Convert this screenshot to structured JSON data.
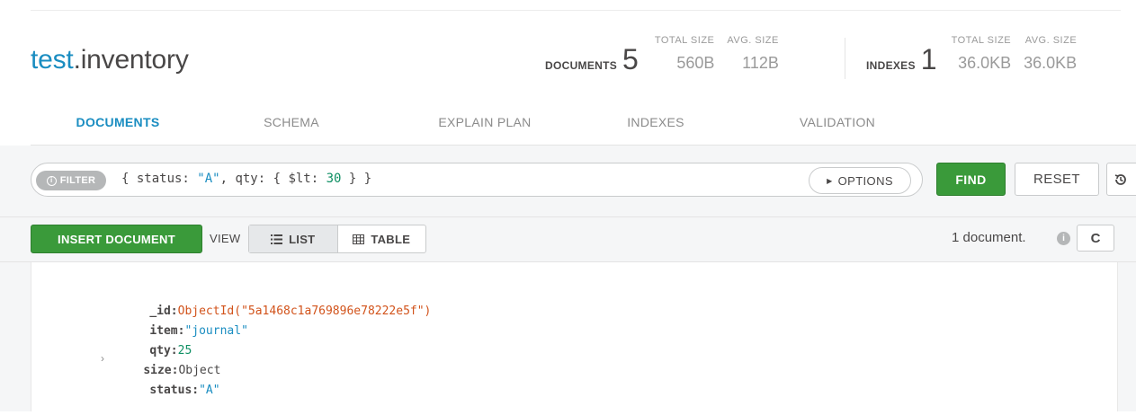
{
  "header": {
    "db": "test",
    "collection": ".inventory",
    "documents": {
      "label": "DOCUMENTS",
      "count": "5",
      "total_size_label": "TOTAL SIZE",
      "total_size": "560B",
      "avg_size_label": "AVG. SIZE",
      "avg_size": "112B"
    },
    "indexes": {
      "label": "INDEXES",
      "count": "1",
      "total_size_label": "TOTAL SIZE",
      "total_size": "36.0KB",
      "avg_size_label": "AVG. SIZE",
      "avg_size": "36.0KB"
    }
  },
  "tabs": [
    {
      "label": "DOCUMENTS",
      "active": true
    },
    {
      "label": "SCHEMA",
      "active": false
    },
    {
      "label": "EXPLAIN PLAN",
      "active": false
    },
    {
      "label": "INDEXES",
      "active": false
    },
    {
      "label": "VALIDATION",
      "active": false
    }
  ],
  "query": {
    "filter_label": "FILTER",
    "filter_tokens": {
      "open": "{ status: ",
      "status_val": "\"A\"",
      "mid": ", qty: { $lt: ",
      "qty_val": "30",
      "close": " } }"
    },
    "options_label": "OPTIONS",
    "find_label": "FIND",
    "reset_label": "RESET"
  },
  "toolbar": {
    "insert_label": "INSERT DOCUMENT",
    "view_label": "VIEW",
    "list_label": "LIST",
    "table_label": "TABLE",
    "active_view": "LIST",
    "doc_count_text": "1 document."
  },
  "document": {
    "fields": [
      {
        "key": "_id",
        "value": "ObjectId(\"5a1468c1a769896e78222e5f\")",
        "type": "oid"
      },
      {
        "key": "item",
        "value": "\"journal\"",
        "type": "str"
      },
      {
        "key": "qty",
        "value": "25",
        "type": "num"
      },
      {
        "key": "size",
        "value": "Object",
        "type": "obj",
        "expandable": true
      },
      {
        "key": "status",
        "value": "\"A\"",
        "type": "str"
      }
    ]
  },
  "colors": {
    "brand_blue": "#1a8dc1",
    "action_green": "#3a9a3a",
    "oid_orange": "#d2531b",
    "number_green": "#0e8f63"
  }
}
